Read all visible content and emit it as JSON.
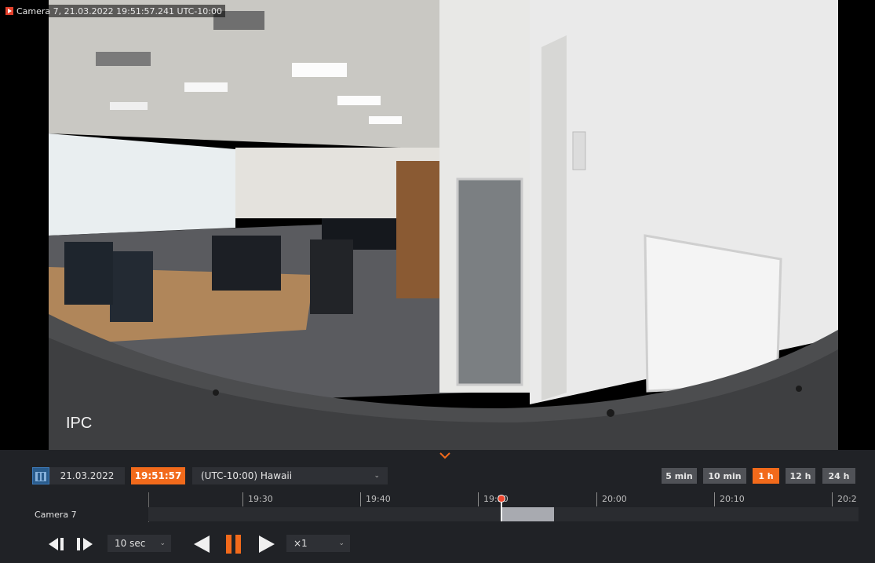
{
  "video": {
    "camera_overlay": "Camera 7, 21.03.2022 19:51:57.241 UTC-10:00",
    "watermark": "IPC"
  },
  "toolbar": {
    "date": "21.03.2022",
    "time": "19:51:57",
    "timezone": "(UTC-10:00) Hawaii",
    "zoom_levels": [
      "5 min",
      "10 min",
      "1 h",
      "12 h",
      "24 h"
    ],
    "zoom_active": "1 h"
  },
  "timeline": {
    "ticks": [
      "19:30",
      "19:40",
      "19:50",
      "20:00",
      "20:10",
      "20:2"
    ],
    "camera_label": "Camera 7"
  },
  "playback": {
    "step_value": "10 sec",
    "speed_value": "×1"
  },
  "colors": {
    "accent": "#f26a1b",
    "panel_bg": "#202226",
    "field_bg": "#2e3035"
  }
}
